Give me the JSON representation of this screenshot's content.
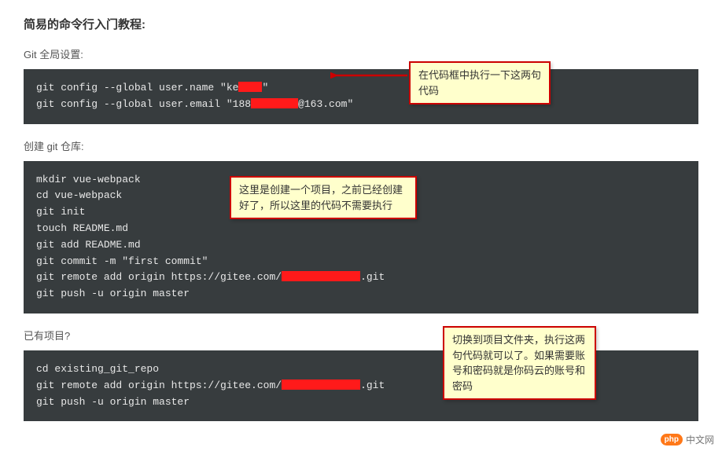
{
  "title": "简易的命令行入门教程:",
  "sections": [
    {
      "label": "Git 全局设置:",
      "code_pre1": "git config --global user.name \"ke",
      "code_post1": "\"",
      "code_pre2": "git config --global user.email \"188",
      "code_post2": "@163.com\""
    },
    {
      "label": "创建 git 仓库:",
      "code_l1": "mkdir vue-webpack",
      "code_l2": "cd vue-webpack",
      "code_l3": "git init",
      "code_l4": "touch README.md",
      "code_l5": "git add README.md",
      "code_l6": "git commit -m \"first commit\"",
      "code_l7_pre": "git remote add origin https://gitee.com/",
      "code_l7_post": ".git",
      "code_l8": "git push -u origin master"
    },
    {
      "label": "已有项目?",
      "code_l1": "cd existing_git_repo",
      "code_l2_pre": "git remote add origin https://gitee.com/",
      "code_l2_post": ".git",
      "code_l3": "git push -u origin master"
    }
  ],
  "annotations": [
    "在代码框中执行一下这两句代码",
    "这里是创建一个项目，之前已经创建好了，所以这里的代码不需要执行",
    "切换到项目文件夹，执行这两句代码就可以了。如果需要账号和密码就是你码云的账号和密码"
  ],
  "watermark": {
    "badge": "php",
    "text": "中文网"
  },
  "colors": {
    "codeBg": "#373c3e",
    "noteBg": "#ffffcc",
    "noteBorder": "#cc0000",
    "redact": "#ff1a1a"
  }
}
